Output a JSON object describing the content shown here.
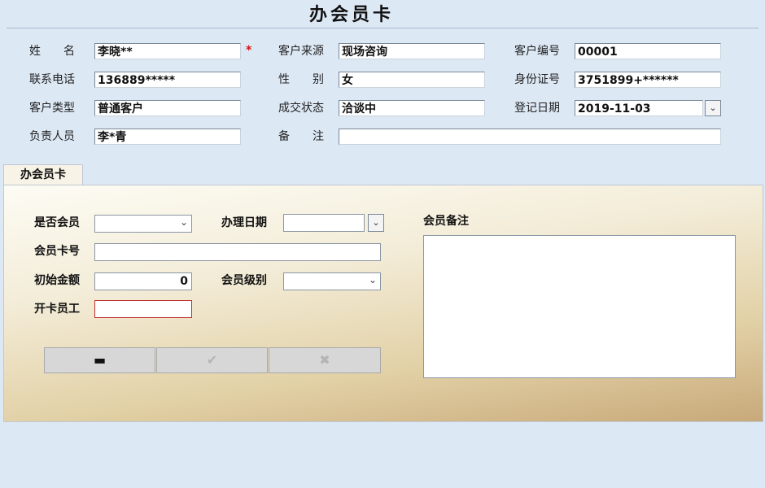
{
  "title": "办会员卡",
  "customer": {
    "name_label": "姓　　名",
    "name_value": "李晓**",
    "required_mark": "*",
    "source_label": "客户来源",
    "source_value": "现场咨询",
    "id_label": "客户编号",
    "id_value": "00001",
    "phone_label": "联系电话",
    "phone_value": "136889*****",
    "gender_label": "性　　别",
    "gender_value": "女",
    "idcard_label": "身份证号",
    "idcard_value": "3751899+******",
    "type_label": "客户类型",
    "type_value": "普通客户",
    "status_label": "成交状态",
    "status_value": "洽谈中",
    "regdate_label": "登记日期",
    "regdate_value": "2019-11-03",
    "owner_label": "负责人员",
    "owner_value": "李*青",
    "remark_label": "备　　注",
    "remark_value": ""
  },
  "tab": {
    "label": "办会员卡"
  },
  "member": {
    "is_member_label": "是否会员",
    "is_member_value": "",
    "handle_date_label": "办理日期",
    "handle_date_value": "",
    "card_no_label": "会员卡号",
    "card_no_value": "",
    "initial_amount_label": "初始金额",
    "initial_amount_value": "0",
    "level_label": "会员级别",
    "level_value": "",
    "staff_label": "开卡员工",
    "staff_value": "",
    "remark_label": "会员备注",
    "remark_value": ""
  },
  "icons": {
    "dropdown": "chevron-down-icon",
    "minus": "minus-icon",
    "check": "check-icon",
    "close": "close-icon"
  },
  "colors": {
    "background": "#dde8f5",
    "required": "#d01010",
    "staff_border": "#c03030"
  }
}
